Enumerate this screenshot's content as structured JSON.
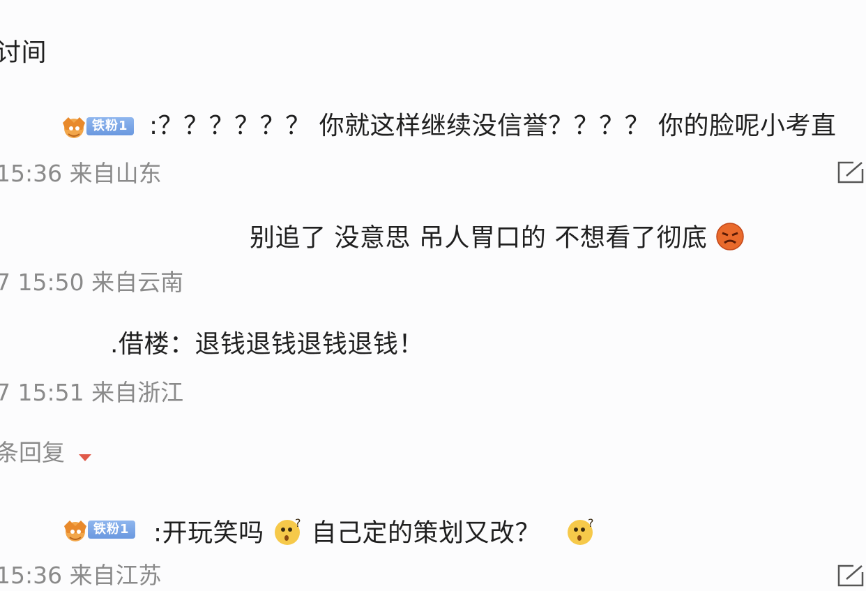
{
  "header": {
    "partial_title": "讨间"
  },
  "comments": [
    {
      "badge_label": "铁粉1",
      "text": ":？？？？？？ 你就这样继续没信誉？？？？ 你的脸呢小考直",
      "meta": "15:36 来自山东"
    },
    {
      "text": "别追了 没意思 吊人胃口的 不想看了彻底",
      "meta": "7 15:50 来自云南"
    },
    {
      "text": ".借楼：退钱退钱退钱退钱！",
      "meta": "7 15:51 来自浙江"
    },
    {
      "badge_label": "铁粉1",
      "text_part1": ":开玩笑吗",
      "text_part2": "自己定的策划又改？",
      "meta": "15:36 来自江苏"
    }
  ],
  "replies_toggle": {
    "label": "条回复"
  },
  "icons": {
    "crown": "crown-fan-icon",
    "edit": "edit-icon",
    "angry": "angry-emoji-icon",
    "confused": "confused-emoji-icon",
    "caret": "caret-down-icon"
  },
  "colors": {
    "meta_text": "#8a8a8a",
    "fan_tag": "#6a98df",
    "caret": "#e05a4a"
  }
}
